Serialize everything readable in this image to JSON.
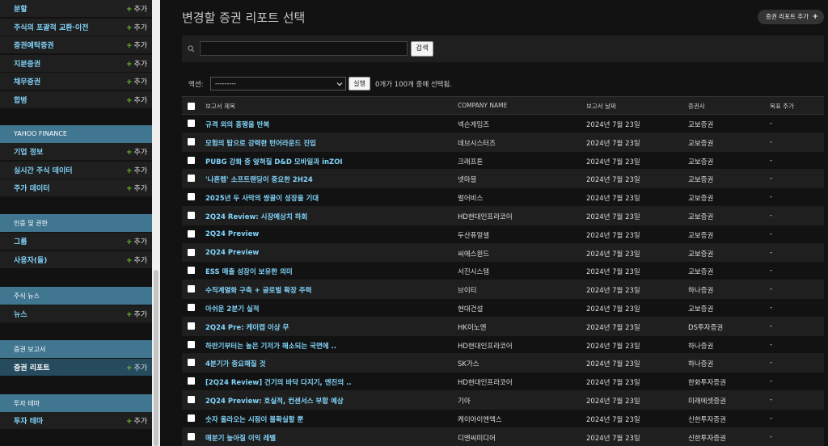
{
  "sidebar": {
    "group1": [
      {
        "label": "분할",
        "add": "추가"
      },
      {
        "label": "주식의 포괄적 교환·이전",
        "add": "추가"
      },
      {
        "label": "증권예탁증권",
        "add": "추가"
      },
      {
        "label": "지분증권",
        "add": "추가"
      },
      {
        "label": "채무증권",
        "add": "추가"
      },
      {
        "label": "합병",
        "add": "추가"
      }
    ],
    "yahoo_caption": "YAHOO FINANCE",
    "yahoo": [
      {
        "label": "기업 정보",
        "add": "추가"
      },
      {
        "label": "실시간 주식 데이터",
        "add": "추가"
      },
      {
        "label": "주가 데이터",
        "add": "추가"
      }
    ],
    "auth_caption": "인증 및 권한",
    "auth": [
      {
        "label": "그룹",
        "add": "추가"
      },
      {
        "label": "사용자(들)",
        "add": "추가"
      }
    ],
    "news_caption": "주식 뉴스",
    "news": [
      {
        "label": "뉴스",
        "add": "추가"
      }
    ],
    "reports_caption": "증권 보고서",
    "reports": [
      {
        "label": "증권 리포트",
        "add": "추가"
      }
    ],
    "theme_caption": "투자 테마",
    "theme": [
      {
        "label": "투자 테마",
        "add": "추가"
      }
    ]
  },
  "content": {
    "title": "변경할 증권 리포트 선택",
    "add_button": "증권 리포트 추가",
    "search_button": "검색",
    "actions_label": "액션:",
    "actions_selected": "---------",
    "run_button": "실행",
    "selection_count": "0개가 100개 중에 선택됨."
  },
  "table": {
    "headers": [
      "보고서 제목",
      "COMPANY NAME",
      "보고서 날짜",
      "증권사",
      "목표 주가"
    ],
    "rows": [
      {
        "title": "규격 외의 흥행을 반복",
        "company": "넥슨게임즈",
        "date": "2024년 7월 23일",
        "broker": "교보증권",
        "target": "-"
      },
      {
        "title": "모험의 탑으로 강력한 턴어라운드 진입",
        "company": "데브시스터즈",
        "date": "2024년 7월 23일",
        "broker": "교보증권",
        "target": "-"
      },
      {
        "title": "PUBG 강화 중 엎혀질 D&D 모바일과 inZOI",
        "company": "크래프톤",
        "date": "2024년 7월 23일",
        "broker": "교보증권",
        "target": "-"
      },
      {
        "title": "'나혼렙' 소프트랜딩이 중요한 2H24",
        "company": "넷마블",
        "date": "2024년 7월 23일",
        "broker": "교보증권",
        "target": "-"
      },
      {
        "title": "2025년 두 사막의 쌍끌이 성장을 기대",
        "company": "펄어비스",
        "date": "2024년 7월 23일",
        "broker": "교보증권",
        "target": "-"
      },
      {
        "title": "2Q24 Review: 시장예상치 하회",
        "company": "HD현대인프라코어",
        "date": "2024년 7월 23일",
        "broker": "교보증권",
        "target": "-"
      },
      {
        "title": "2Q24 Preview",
        "company": "두산퓨얼셀",
        "date": "2024년 7월 23일",
        "broker": "교보증권",
        "target": "-"
      },
      {
        "title": "2Q24 Preview",
        "company": "씨에스윈드",
        "date": "2024년 7월 23일",
        "broker": "교보증권",
        "target": "-"
      },
      {
        "title": "ESS 매출 성장이 보유한 의미",
        "company": "서진시스템",
        "date": "2024년 7월 23일",
        "broker": "교보증권",
        "target": "-"
      },
      {
        "title": "수직계열화 구축 + 글로벌 확장 주력",
        "company": "브이티",
        "date": "2024년 7월 23일",
        "broker": "하나증권",
        "target": "-"
      },
      {
        "title": "아쉬운 2분기 실적",
        "company": "현대건설",
        "date": "2024년 7월 23일",
        "broker": "교보증권",
        "target": "-"
      },
      {
        "title": "2Q24 Pre: 케이캡 이상 무",
        "company": "HK이노엔",
        "date": "2024년 7월 23일",
        "broker": "DS투자증권",
        "target": "-"
      },
      {
        "title": "하반기부터는 높은 기저가 해소되는 국면에 ..",
        "company": "HD현대인프라코어",
        "date": "2024년 7월 23일",
        "broker": "하나증권",
        "target": "-"
      },
      {
        "title": "4분기가 중요해질 것",
        "company": "SK가스",
        "date": "2024년 7월 23일",
        "broker": "하나증권",
        "target": "-"
      },
      {
        "title": "[2Q24 Review] 건기의 바닥 다지기, 엔진의 ..",
        "company": "HD현대인프라코어",
        "date": "2024년 7월 23일",
        "broker": "한화투자증권",
        "target": "-"
      },
      {
        "title": "2Q24 Preview: 호실적, 컨센서스 부합 예상",
        "company": "기아",
        "date": "2024년 7월 23일",
        "broker": "미래에셋증권",
        "target": "-"
      },
      {
        "title": "숫자 올라오는 시점이 불확실할 뿐",
        "company": "케이아이엔엑스",
        "date": "2024년 7월 23일",
        "broker": "신한투자증권",
        "target": "-"
      },
      {
        "title": "매분기 높아질 이익 레벨",
        "company": "디엔씨미디어",
        "date": "2024년 7월 23일",
        "broker": "신한투자증권",
        "target": "-"
      }
    ]
  }
}
